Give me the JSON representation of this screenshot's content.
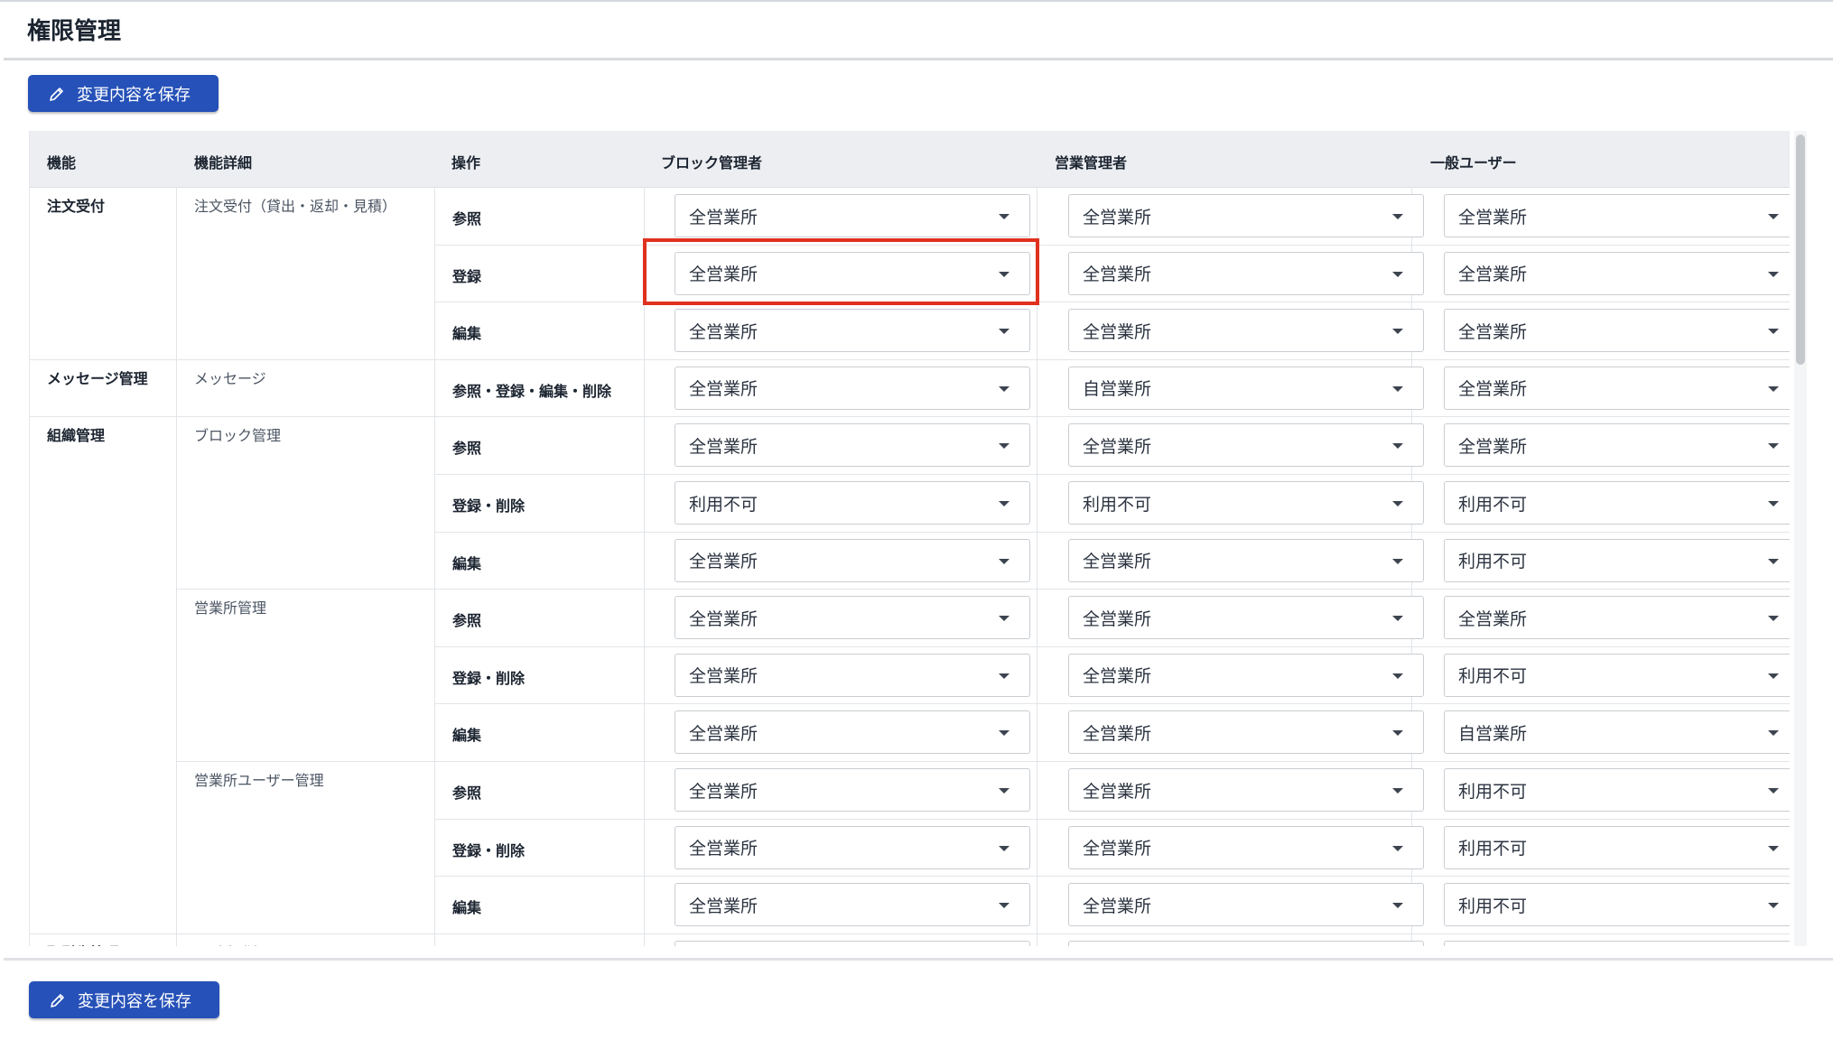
{
  "page": {
    "title": "権限管理"
  },
  "toolbar": {
    "save_label": "変更内容を保存"
  },
  "table": {
    "headers": [
      "機能",
      "機能詳細",
      "操作",
      "ブロック管理者",
      "営業管理者",
      "一般ユーザー"
    ],
    "rows": [
      {
        "func": "注文受付",
        "detail": "注文受付（貸出・返却・見積）",
        "op": "参照",
        "vals": [
          "全営業所",
          "全営業所",
          "全営業所"
        ]
      },
      {
        "func": "",
        "detail": "",
        "op": "登録",
        "vals": [
          "全営業所",
          "全営業所",
          "全営業所"
        ]
      },
      {
        "func": "",
        "detail": "",
        "op": "編集",
        "vals": [
          "全営業所",
          "全営業所",
          "全営業所"
        ]
      },
      {
        "func": "メッセージ管理",
        "detail": "メッセージ",
        "op": "参照・登録・編集・削除",
        "vals": [
          "全営業所",
          "自営業所",
          "全営業所"
        ]
      },
      {
        "func": "組織管理",
        "detail": "ブロック管理",
        "op": "参照",
        "vals": [
          "全営業所",
          "全営業所",
          "全営業所"
        ]
      },
      {
        "func": "",
        "detail": "",
        "op": "登録・削除",
        "vals": [
          "利用不可",
          "利用不可",
          "利用不可"
        ]
      },
      {
        "func": "",
        "detail": "",
        "op": "編集",
        "vals": [
          "全営業所",
          "全営業所",
          "利用不可"
        ]
      },
      {
        "func": "",
        "detail": "営業所管理",
        "op": "参照",
        "vals": [
          "全営業所",
          "全営業所",
          "全営業所"
        ]
      },
      {
        "func": "",
        "detail": "",
        "op": "登録・削除",
        "vals": [
          "全営業所",
          "全営業所",
          "利用不可"
        ]
      },
      {
        "func": "",
        "detail": "",
        "op": "編集",
        "vals": [
          "全営業所",
          "全営業所",
          "自営業所"
        ]
      },
      {
        "func": "",
        "detail": "営業所ユーザー管理",
        "op": "参照",
        "vals": [
          "全営業所",
          "全営業所",
          "利用不可"
        ]
      },
      {
        "func": "",
        "detail": "",
        "op": "登録・削除",
        "vals": [
          "全営業所",
          "全営業所",
          "利用不可"
        ]
      },
      {
        "func": "",
        "detail": "",
        "op": "編集",
        "vals": [
          "全営業所",
          "全営業所",
          "利用不可"
        ]
      },
      {
        "func": "取引先管理",
        "detail": "取引先登録",
        "op": "",
        "vals": [
          "",
          "",
          ""
        ]
      }
    ]
  },
  "colors": {
    "accent": "#2651b8",
    "highlight": "#e0311f"
  },
  "icons": {
    "save": "pencil-icon",
    "dropdown": "caret-down-icon"
  }
}
